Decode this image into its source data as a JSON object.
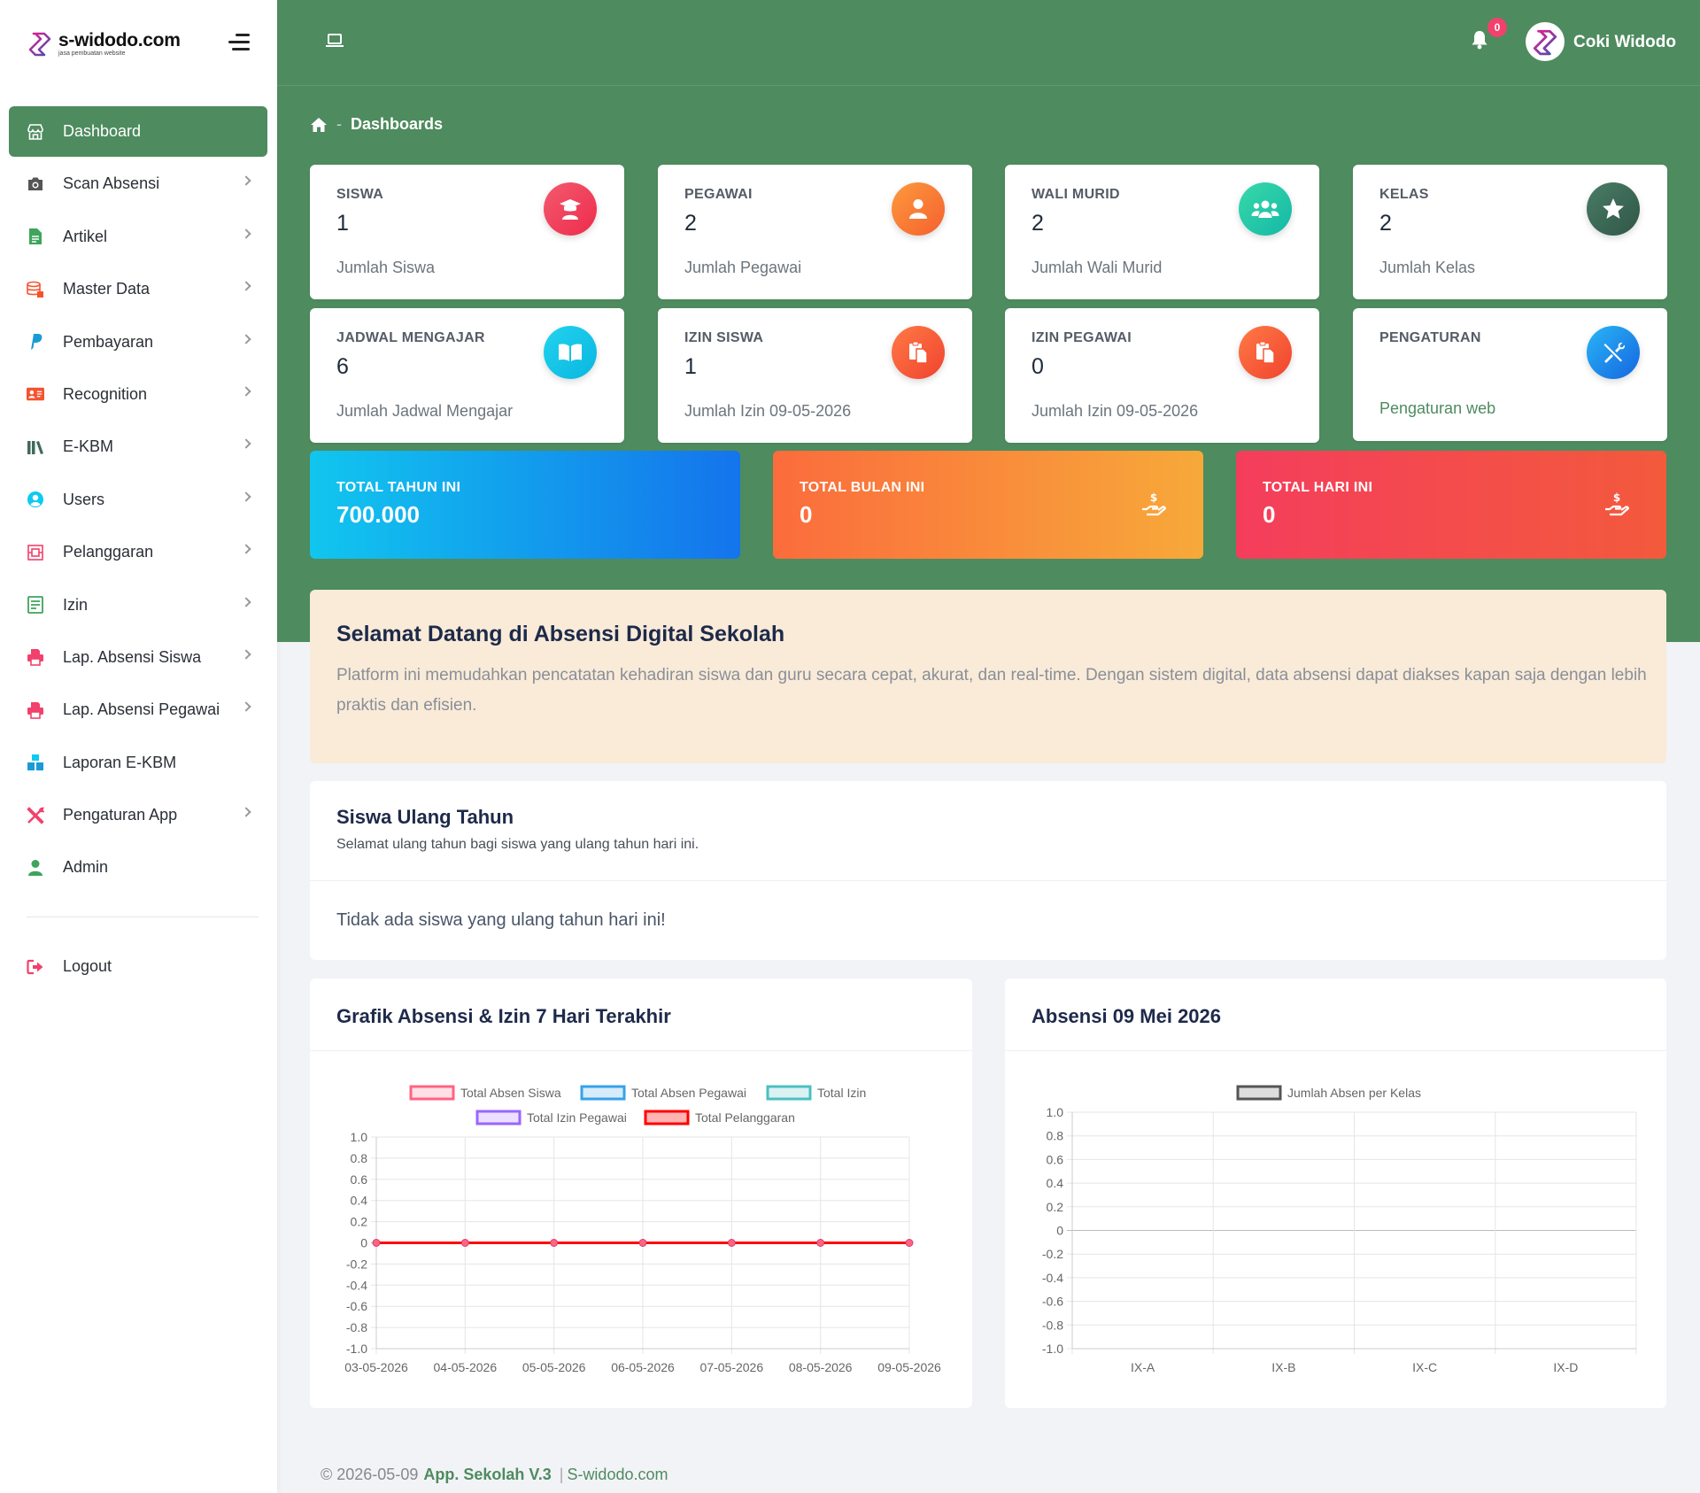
{
  "brand": {
    "name": "s-widodo.com",
    "tagline": "jasa pembuatan website"
  },
  "sidebar": {
    "items": [
      {
        "label": "Dashboard",
        "icon": "store-icon",
        "active": true,
        "chevron": false
      },
      {
        "label": "Scan Absensi",
        "icon": "camera-icon",
        "active": false,
        "chevron": true
      },
      {
        "label": "Artikel",
        "icon": "file-icon",
        "active": false,
        "chevron": true
      },
      {
        "label": "Master Data",
        "icon": "database-icon",
        "active": false,
        "chevron": true
      },
      {
        "label": "Pembayaran",
        "icon": "paypal-icon",
        "active": false,
        "chevron": true
      },
      {
        "label": "Recognition",
        "icon": "id-card-icon",
        "active": false,
        "chevron": true
      },
      {
        "label": "E-KBM",
        "icon": "library-icon",
        "active": false,
        "chevron": true
      },
      {
        "label": "Users",
        "icon": "user-circle-icon",
        "active": false,
        "chevron": true
      },
      {
        "label": "Pelanggaran",
        "icon": "ticket-icon",
        "active": false,
        "chevron": true
      },
      {
        "label": "Izin",
        "icon": "list-icon",
        "active": false,
        "chevron": true
      },
      {
        "label": "Lap. Absensi Siswa",
        "icon": "print-icon",
        "active": false,
        "chevron": true
      },
      {
        "label": "Lap. Absensi Pegawai",
        "icon": "print-icon",
        "active": false,
        "chevron": true
      },
      {
        "label": "Laporan E-KBM",
        "icon": "boxes-icon",
        "active": false,
        "chevron": false
      },
      {
        "label": "Pengaturan App",
        "icon": "tools-icon",
        "active": false,
        "chevron": true
      },
      {
        "label": "Admin",
        "icon": "user-icon",
        "active": false,
        "chevron": false
      }
    ],
    "logout": "Logout"
  },
  "header": {
    "notification_count": "0",
    "user_name": "Coki Widodo"
  },
  "breadcrumb": {
    "current": "Dashboards"
  },
  "stats": [
    {
      "title": "SISWA",
      "value": "1",
      "sub": "Jumlah Siswa",
      "icon": "graduate-icon",
      "color": "#f1416c"
    },
    {
      "title": "PEGAWAI",
      "value": "2",
      "sub": "Jumlah Pegawai",
      "icon": "user-icon",
      "color": "#fd7e14"
    },
    {
      "title": "WALI MURID",
      "value": "2",
      "sub": "Jumlah Wali Murid",
      "icon": "users-icon",
      "color": "#20c997"
    },
    {
      "title": "KELAS",
      "value": "2",
      "sub": "Jumlah Kelas",
      "icon": "star-icon",
      "color": "#3f6b5a"
    },
    {
      "title": "JADWAL MENGAJAR",
      "value": "6",
      "sub": "Jumlah Jadwal Mengajar",
      "icon": "book-icon",
      "color": "#0dcaf0"
    },
    {
      "title": "IZIN SISWA",
      "value": "1",
      "sub": "Jumlah Izin 09-05-2026",
      "icon": "paste-icon",
      "color": "#f5532f"
    },
    {
      "title": "IZIN PEGAWAI",
      "value": "0",
      "sub": "Jumlah Izin 09-05-2026",
      "icon": "paste-icon",
      "color": "#f5532f"
    },
    {
      "title": "PENGATURAN",
      "value": "",
      "sub": "Pengaturan web",
      "icon": "tools-icon",
      "color": "#1e88e5"
    }
  ],
  "totals": [
    {
      "title": "TOTAL TAHUN INI",
      "value": "700.000",
      "from": "#11c6ee",
      "to": "#1474ec"
    },
    {
      "title": "TOTAL BULAN INI",
      "value": "0",
      "from": "#fb6c3c",
      "to": "#f7a93a"
    },
    {
      "title": "TOTAL HARI INI",
      "value": "0",
      "from": "#f43d5c",
      "to": "#f35a3c"
    }
  ],
  "welcome": {
    "title": "Selamat Datang di Absensi Digital Sekolah",
    "text": "Platform ini memudahkan pencatatan kehadiran siswa dan guru secara cepat, akurat, dan real-time. Dengan sistem digital, data absensi dapat diakses kapan saja dengan lebih praktis dan efisien."
  },
  "birthday": {
    "title": "Siswa Ulang Tahun",
    "subtitle": "Selamat ulang tahun bagi siswa yang ulang tahun hari ini.",
    "empty": "Tidak ada siswa yang ulang tahun hari ini!"
  },
  "chart_data": [
    {
      "type": "line",
      "title": "Grafik Absensi & Izin 7 Hari Terakhir",
      "categories": [
        "03-05-2026",
        "04-05-2026",
        "05-05-2026",
        "06-05-2026",
        "07-05-2026",
        "08-05-2026",
        "09-05-2026"
      ],
      "series": [
        {
          "name": "Total Absen Siswa",
          "values": [
            0,
            0,
            0,
            0,
            0,
            0,
            0
          ],
          "color": "#ff6384",
          "fill": "#ffe0e6"
        },
        {
          "name": "Total Absen Pegawai",
          "values": [
            0,
            0,
            0,
            0,
            0,
            0,
            0
          ],
          "color": "#36a2eb",
          "fill": "#d7ecfb"
        },
        {
          "name": "Total Izin",
          "values": [
            0,
            0,
            0,
            0,
            0,
            0,
            0
          ],
          "color": "#4bc0c0",
          "fill": "#dbf2f2"
        },
        {
          "name": "Total Izin Pegawai",
          "values": [
            0,
            0,
            0,
            0,
            0,
            0,
            0
          ],
          "color": "#9966ff",
          "fill": "#ebe0ff"
        },
        {
          "name": "Total Pelanggaran",
          "values": [
            0,
            0,
            0,
            0,
            0,
            0,
            0
          ],
          "color": "#ff0000",
          "fill": "#ffb3b3"
        }
      ],
      "ylim": [
        -1,
        1
      ],
      "yticks": [
        "1.0",
        "0.8",
        "0.6",
        "0.4",
        "0.2",
        "0",
        "-0.2",
        "-0.4",
        "-0.6",
        "-0.8",
        "-1.0"
      ],
      "legend": "top",
      "grid": true
    },
    {
      "type": "bar",
      "title": "Absensi 09 Mei 2026",
      "categories": [
        "IX-A",
        "IX-B",
        "IX-C",
        "IX-D"
      ],
      "series": [
        {
          "name": "Jumlah Absen per Kelas",
          "values": [
            0,
            0,
            0,
            0
          ],
          "color": "#555555",
          "fill": "#dddddd"
        }
      ],
      "ylim": [
        -1,
        1
      ],
      "yticks": [
        "1.0",
        "0.8",
        "0.6",
        "0.4",
        "0.2",
        "0",
        "-0.2",
        "-0.4",
        "-0.6",
        "-0.8",
        "-1.0"
      ],
      "legend": "top",
      "grid": true
    }
  ],
  "footer": {
    "date": "© 2026-05-09",
    "app": "App. Sekolah V.3",
    "separator": "|",
    "site": "S-widodo.com"
  }
}
